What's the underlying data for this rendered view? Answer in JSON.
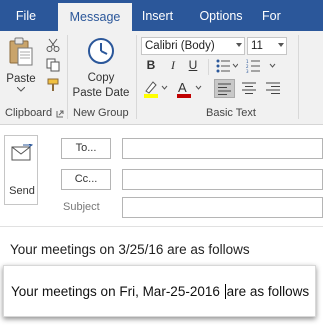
{
  "tabs": [
    "File",
    "Message",
    "Insert",
    "Options",
    "For"
  ],
  "ribbon": {
    "clipboard": {
      "paste_label": "Paste",
      "group_label": "Clipboard"
    },
    "new_group": {
      "copy_label_1": "Copy",
      "copy_label_2": "Paste Date",
      "group_label": "New Group"
    },
    "basic_text": {
      "font_name": "Calibri (Body)",
      "font_size": "11",
      "group_label": "Basic Text"
    }
  },
  "compose": {
    "send_label": "Send",
    "to_label": "To...",
    "cc_label": "Cc...",
    "subject_label": "Subject",
    "body_text": "Your meetings on 3/25/16 are as follows"
  },
  "callout": {
    "text_before_cursor": "Your meetings on Fri, Mar-25-2016",
    "text_after_cursor": "are as follows"
  },
  "colors": {
    "tab_bar": "#2b579a",
    "ribbon": "#f1f1f1",
    "highlight": "#ffff00",
    "font_color": "#c00000"
  }
}
